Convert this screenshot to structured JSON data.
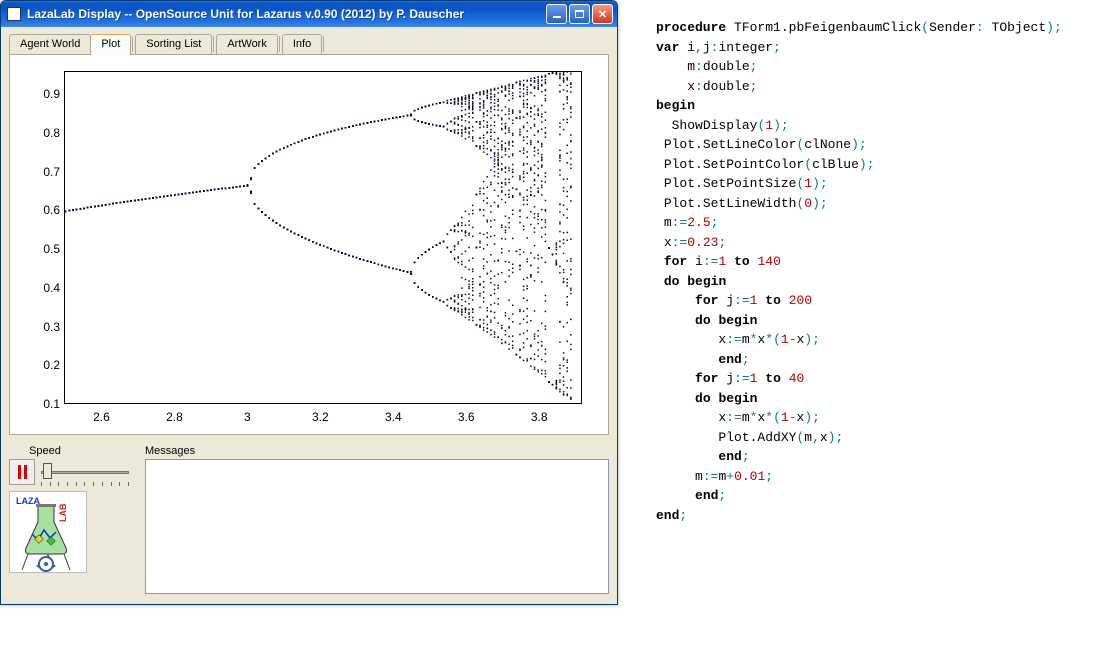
{
  "window": {
    "title": "LazaLab Display -- OpenSource Unit for Lazarus  v.0.90 (2012) by P. Dauscher"
  },
  "tabs": [
    "Agent World",
    "Plot",
    "Sorting List",
    "ArtWork",
    "Info"
  ],
  "active_tab": 1,
  "labels": {
    "speed": "Speed",
    "messages": "Messages"
  },
  "logo": {
    "top": "LAZA",
    "side": "LAB"
  },
  "chart_data": {
    "type": "scatter",
    "title": "",
    "xlabel": "",
    "ylabel": "",
    "xlim": [
      2.5,
      3.92
    ],
    "ylim": [
      0.1,
      0.96
    ],
    "xticks": [
      2.6,
      2.8,
      3.0,
      3.2,
      3.4,
      3.6,
      3.8
    ],
    "yticks": [
      0.1,
      0.2,
      0.3,
      0.4,
      0.5,
      0.6,
      0.7,
      0.8,
      0.9
    ],
    "description": "Feigenbaum bifurcation diagram; generated from logistic map x:=m*x*(1-x), m from 2.5 to 3.9 step 0.01, 200 iterations transient, 40 plotted."
  },
  "code": {
    "lines": [
      [
        [
          "kw",
          "procedure"
        ],
        [
          "sp",
          " "
        ],
        [
          "id",
          "TForm1.pbFeigenbaumClick"
        ],
        [
          "teal",
          "("
        ],
        [
          "id",
          "Sender"
        ],
        [
          "teal",
          ":"
        ],
        [
          "sp",
          " "
        ],
        [
          "id",
          "TObject"
        ],
        [
          "teal",
          ")"
        ],
        [
          "teal",
          ";"
        ]
      ],
      [
        [
          "kw",
          "var"
        ],
        [
          "sp",
          " "
        ],
        [
          "id",
          "i"
        ],
        [
          "teal",
          ","
        ],
        [
          "id",
          "j"
        ],
        [
          "teal",
          ":"
        ],
        [
          "id",
          "integer"
        ],
        [
          "teal",
          ";"
        ]
      ],
      [
        [
          "sp",
          "    "
        ],
        [
          "id",
          "m"
        ],
        [
          "teal",
          ":"
        ],
        [
          "id",
          "double"
        ],
        [
          "teal",
          ";"
        ]
      ],
      [
        [
          "sp",
          "    "
        ],
        [
          "id",
          "x"
        ],
        [
          "teal",
          ":"
        ],
        [
          "id",
          "double"
        ],
        [
          "teal",
          ";"
        ]
      ],
      [
        [
          "kw",
          "begin"
        ]
      ],
      [
        [
          "sp",
          "  "
        ],
        [
          "id",
          "ShowDisplay"
        ],
        [
          "teal",
          "("
        ],
        [
          "num",
          "1"
        ],
        [
          "teal",
          ")"
        ],
        [
          "teal",
          ";"
        ]
      ],
      [
        [
          "sp",
          " "
        ],
        [
          "id",
          "Plot.SetLineColor"
        ],
        [
          "teal",
          "("
        ],
        [
          "id",
          "clNone"
        ],
        [
          "teal",
          ")"
        ],
        [
          "teal",
          ";"
        ]
      ],
      [
        [
          "sp",
          " "
        ],
        [
          "id",
          "Plot.SetPointColor"
        ],
        [
          "teal",
          "("
        ],
        [
          "id",
          "clBlue"
        ],
        [
          "teal",
          ")"
        ],
        [
          "teal",
          ";"
        ]
      ],
      [
        [
          "sp",
          " "
        ],
        [
          "id",
          "Plot.SetPointSize"
        ],
        [
          "teal",
          "("
        ],
        [
          "num",
          "1"
        ],
        [
          "teal",
          ")"
        ],
        [
          "teal",
          ";"
        ]
      ],
      [
        [
          "sp",
          " "
        ],
        [
          "id",
          "Plot.SetLineWidth"
        ],
        [
          "teal",
          "("
        ],
        [
          "num",
          "0"
        ],
        [
          "teal",
          ")"
        ],
        [
          "teal",
          ";"
        ]
      ],
      [
        [
          "sp",
          " "
        ],
        [
          "id",
          "m"
        ],
        [
          "teal",
          ":="
        ],
        [
          "num",
          "2.5"
        ],
        [
          "teal",
          ";"
        ]
      ],
      [
        [
          "sp",
          " "
        ],
        [
          "id",
          "x"
        ],
        [
          "teal",
          ":="
        ],
        [
          "num",
          "0.23"
        ],
        [
          "teal",
          ";"
        ]
      ],
      [
        [
          "sp",
          " "
        ],
        [
          "kw",
          "for"
        ],
        [
          "sp",
          " "
        ],
        [
          "id",
          "i"
        ],
        [
          "teal",
          ":="
        ],
        [
          "num",
          "1"
        ],
        [
          "sp",
          " "
        ],
        [
          "kw",
          "to"
        ],
        [
          "sp",
          " "
        ],
        [
          "num",
          "140"
        ]
      ],
      [
        [
          "sp",
          " "
        ],
        [
          "kw",
          "do"
        ],
        [
          "sp",
          " "
        ],
        [
          "kw",
          "begin"
        ]
      ],
      [
        [
          "sp",
          "     "
        ],
        [
          "kw",
          "for"
        ],
        [
          "sp",
          " "
        ],
        [
          "id",
          "j"
        ],
        [
          "teal",
          ":="
        ],
        [
          "num",
          "1"
        ],
        [
          "sp",
          " "
        ],
        [
          "kw",
          "to"
        ],
        [
          "sp",
          " "
        ],
        [
          "num",
          "200"
        ]
      ],
      [
        [
          "sp",
          "     "
        ],
        [
          "kw",
          "do"
        ],
        [
          "sp",
          " "
        ],
        [
          "kw",
          "begin"
        ]
      ],
      [
        [
          "sp",
          "        "
        ],
        [
          "id",
          "x"
        ],
        [
          "teal",
          ":="
        ],
        [
          "id",
          "m"
        ],
        [
          "teal",
          "*"
        ],
        [
          "id",
          "x"
        ],
        [
          "teal",
          "*"
        ],
        [
          "teal",
          "("
        ],
        [
          "num",
          "1"
        ],
        [
          "teal",
          "-"
        ],
        [
          "id",
          "x"
        ],
        [
          "teal",
          ")"
        ],
        [
          "teal",
          ";"
        ]
      ],
      [
        [
          "sp",
          "        "
        ],
        [
          "kw",
          "end"
        ],
        [
          "teal",
          ";"
        ]
      ],
      [
        [
          "sp",
          "     "
        ],
        [
          "kw",
          "for"
        ],
        [
          "sp",
          " "
        ],
        [
          "id",
          "j"
        ],
        [
          "teal",
          ":="
        ],
        [
          "num",
          "1"
        ],
        [
          "sp",
          " "
        ],
        [
          "kw",
          "to"
        ],
        [
          "sp",
          " "
        ],
        [
          "num",
          "40"
        ]
      ],
      [
        [
          "sp",
          "     "
        ],
        [
          "kw",
          "do"
        ],
        [
          "sp",
          " "
        ],
        [
          "kw",
          "begin"
        ]
      ],
      [
        [
          "sp",
          "        "
        ],
        [
          "id",
          "x"
        ],
        [
          "teal",
          ":="
        ],
        [
          "id",
          "m"
        ],
        [
          "teal",
          "*"
        ],
        [
          "id",
          "x"
        ],
        [
          "teal",
          "*"
        ],
        [
          "teal",
          "("
        ],
        [
          "num",
          "1"
        ],
        [
          "teal",
          "-"
        ],
        [
          "id",
          "x"
        ],
        [
          "teal",
          ")"
        ],
        [
          "teal",
          ";"
        ]
      ],
      [
        [
          "sp",
          "        "
        ],
        [
          "id",
          "Plot.AddXY"
        ],
        [
          "teal",
          "("
        ],
        [
          "id",
          "m"
        ],
        [
          "teal",
          ","
        ],
        [
          "id",
          "x"
        ],
        [
          "teal",
          ")"
        ],
        [
          "teal",
          ";"
        ]
      ],
      [
        [
          "sp",
          "        "
        ],
        [
          "kw",
          "end"
        ],
        [
          "teal",
          ";"
        ]
      ],
      [
        [
          "sp",
          "     "
        ],
        [
          "id",
          "m"
        ],
        [
          "teal",
          ":="
        ],
        [
          "id",
          "m"
        ],
        [
          "teal",
          "+"
        ],
        [
          "num",
          "0.01"
        ],
        [
          "teal",
          ";"
        ]
      ],
      [
        [
          "sp",
          "     "
        ],
        [
          "kw",
          "end"
        ],
        [
          "teal",
          ";"
        ]
      ],
      [
        [
          "kw",
          "end"
        ],
        [
          "teal",
          ";"
        ]
      ]
    ]
  }
}
